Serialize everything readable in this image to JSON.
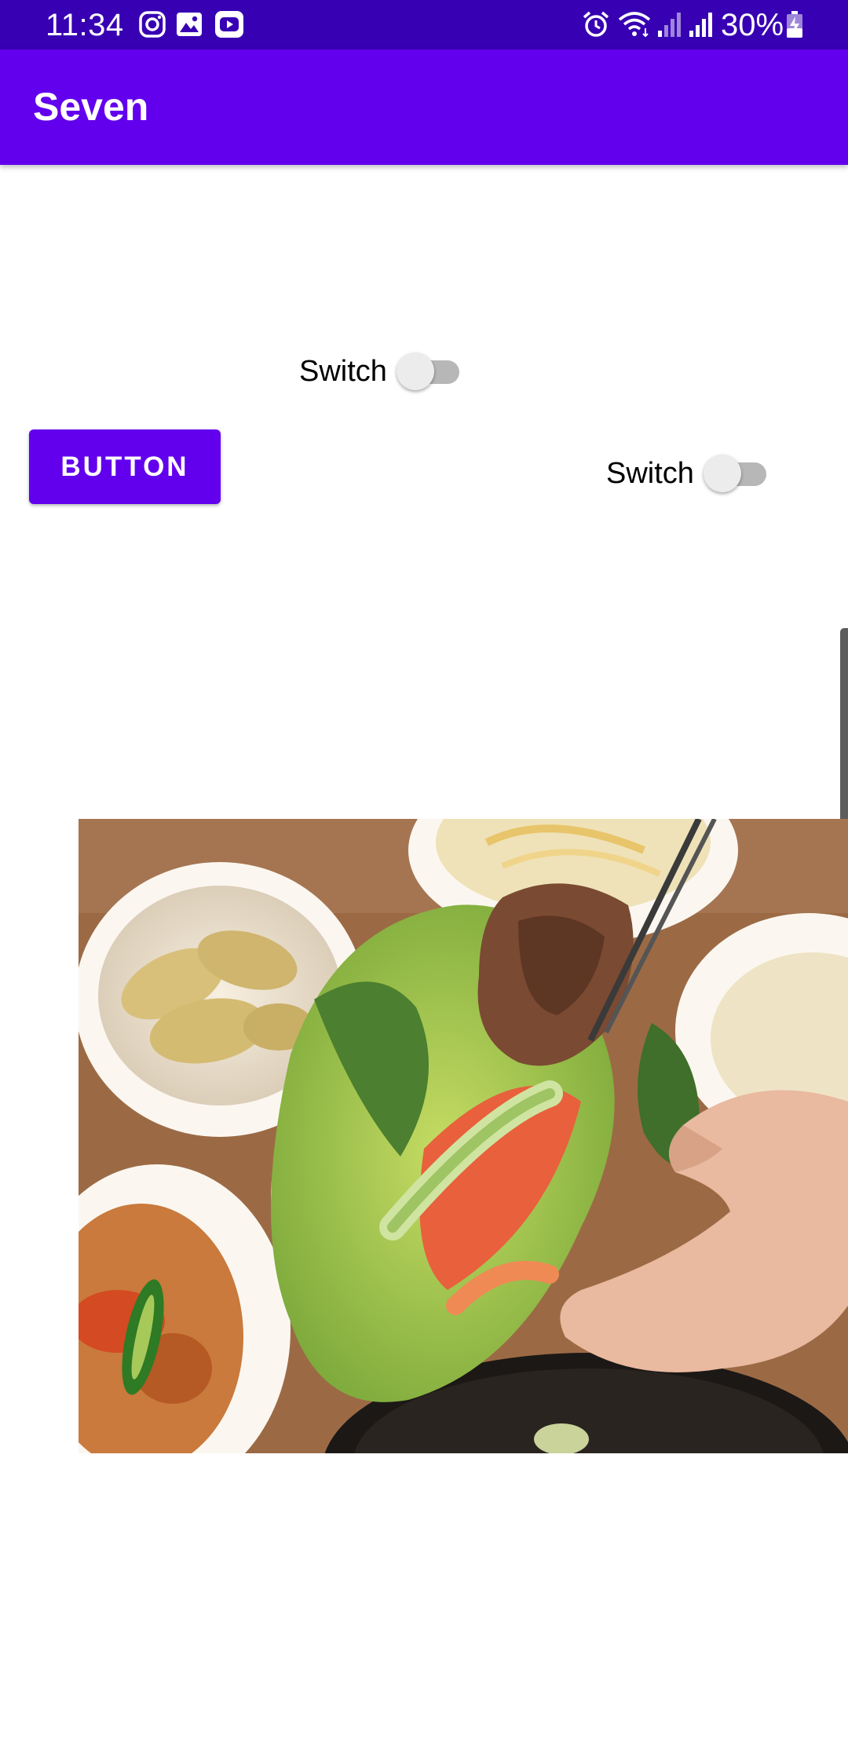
{
  "status_bar": {
    "time": "11:34",
    "battery": "30%",
    "left_icons": [
      "instagram-icon",
      "gallery-icon",
      "youtube-icon"
    ],
    "right_icons": [
      "alarm-icon",
      "wifi-icon",
      "signal-icon",
      "signal-icon",
      "battery-charging-icon"
    ]
  },
  "app_bar": {
    "title": "Seven"
  },
  "switches": [
    {
      "label": "Switch",
      "checked": false
    },
    {
      "label": "Switch",
      "checked": false
    }
  ],
  "button": {
    "label": "BUTTON"
  },
  "image": {
    "subject": "korean-bbq-lettuce-wrap-photo"
  },
  "colors": {
    "status_bar": "#3700B3",
    "primary": "#6200EE",
    "switch_track": "#b7b7b7",
    "switch_thumb": "#ececec"
  }
}
